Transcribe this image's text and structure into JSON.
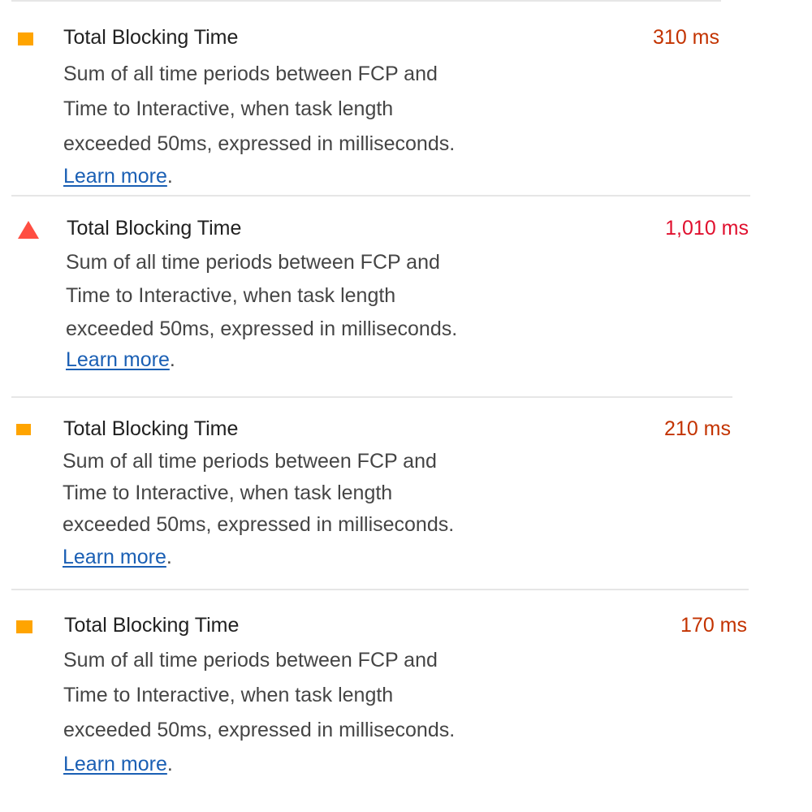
{
  "colors": {
    "average": "#ffa400",
    "fail": "#ff4e42",
    "value_average": "#c33300",
    "value_fail": "#e0102e",
    "link": "#1a5fb4"
  },
  "metrics": [
    {
      "title": "Total Blocking Time",
      "value": "310 ms",
      "status": "average",
      "icon": "orange-square-icon",
      "description": [
        "Sum of all time periods between FCP and",
        "Time to Interactive, when task length",
        "exceeded 50ms, expressed in milliseconds."
      ],
      "link": "Learn more",
      "link_suffix": "."
    },
    {
      "title": "Total Blocking Time",
      "value": "1,010 ms",
      "status": "fail",
      "icon": "red-triangle-icon",
      "description": [
        "Sum of all time periods between FCP and",
        "Time to Interactive, when task length",
        "exceeded 50ms, expressed in milliseconds."
      ],
      "link": "Learn more",
      "link_suffix": "."
    },
    {
      "title": "Total Blocking Time",
      "value": "210 ms",
      "status": "average",
      "icon": "orange-square-icon",
      "description": [
        "Sum of all time periods between FCP and",
        "Time to Interactive, when task length",
        "exceeded 50ms, expressed in milliseconds."
      ],
      "link": "Learn more",
      "link_suffix": "."
    },
    {
      "title": "Total Blocking Time",
      "value": "170 ms",
      "status": "average",
      "icon": "orange-square-icon",
      "description": [
        "Sum of all time periods between FCP and",
        "Time to Interactive, when task length",
        "exceeded 50ms, expressed in milliseconds."
      ],
      "link": "Learn more",
      "link_suffix": "."
    }
  ]
}
